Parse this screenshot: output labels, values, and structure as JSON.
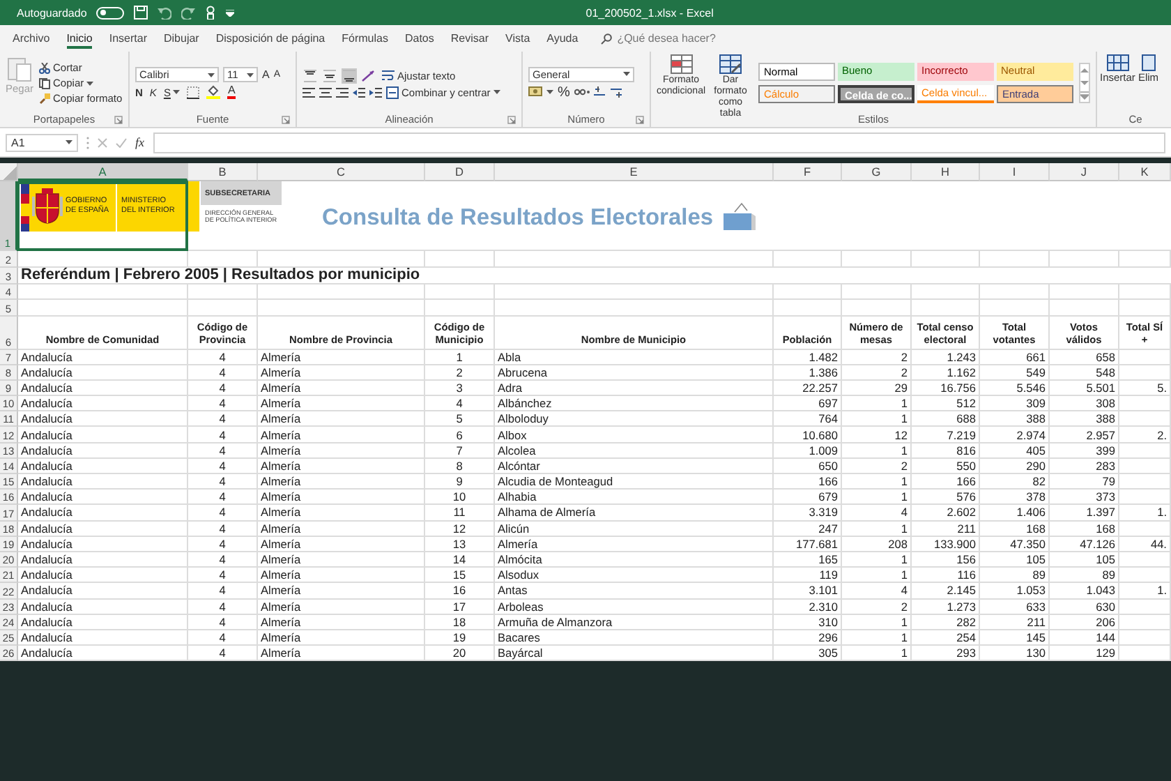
{
  "window": {
    "title": "01_200502_1.xlsx - Excel"
  },
  "quick_access": {
    "autosave_label": "Autoguardado",
    "autosave_on": false
  },
  "menu_tabs": [
    {
      "label": "Archivo",
      "selected": false
    },
    {
      "label": "Inicio",
      "selected": true
    },
    {
      "label": "Insertar",
      "selected": false
    },
    {
      "label": "Dibujar",
      "selected": false
    },
    {
      "label": "Disposición de página",
      "selected": false
    },
    {
      "label": "Fórmulas",
      "selected": false
    },
    {
      "label": "Datos",
      "selected": false
    },
    {
      "label": "Revisar",
      "selected": false
    },
    {
      "label": "Vista",
      "selected": false
    },
    {
      "label": "Ayuda",
      "selected": false
    }
  ],
  "tell_me": {
    "placeholder": "¿Qué desea hacer?"
  },
  "ribbon": [
    {
      "kind": "clipboard",
      "name": "Portapapeles",
      "paste": "Pegar",
      "paste_disabled": true,
      "cut": "Cortar",
      "copy": "Copiar",
      "format_painter": "Copiar formato"
    },
    {
      "kind": "font",
      "name": "Fuente",
      "font_name": "Calibri",
      "font_size": "11",
      "grow": "A",
      "shrink": "A",
      "bold": "N",
      "italic": "K",
      "underline": "S",
      "font_color": "A"
    },
    {
      "kind": "alignment",
      "name": "Alineación",
      "vertical": [
        {
          "selected": false
        },
        {
          "selected": false
        },
        {
          "selected": true
        }
      ],
      "wrap": "Ajustar texto",
      "merge": "Combinar y centrar"
    },
    {
      "kind": "number",
      "name": "Número",
      "format": "General",
      "percent": "%"
    },
    {
      "kind": "styles",
      "name": "Estilos",
      "conditional": "Formato condicional",
      "as_table": "Dar formato como tabla",
      "cell_styles": [
        {
          "kind": "normal",
          "label": "Normal"
        },
        {
          "kind": "good",
          "label": "Bueno"
        },
        {
          "kind": "bad",
          "label": "Incorrecto"
        },
        {
          "kind": "neutral",
          "label": "Neutral"
        },
        {
          "kind": "calculation",
          "label": "Cálculo"
        },
        {
          "kind": "check",
          "label": "Celda de co..."
        },
        {
          "kind": "linked",
          "label": "Celda vincul..."
        },
        {
          "kind": "input",
          "label": "Entrada"
        }
      ]
    },
    {
      "kind": "cells",
      "name": "Ce",
      "insert": "Insertar",
      "delete": "Elim"
    }
  ],
  "formula_bar": {
    "name_box": "A1",
    "function_label": "fx"
  },
  "sheet": {
    "columns": [
      {
        "label": "A",
        "selected": true
      },
      {
        "label": "B",
        "selected": false
      },
      {
        "label": "C",
        "selected": false
      },
      {
        "label": "D",
        "selected": false
      },
      {
        "label": "E",
        "selected": false
      },
      {
        "label": "F",
        "selected": false
      },
      {
        "label": "G",
        "selected": false
      },
      {
        "label": "H",
        "selected": false
      },
      {
        "label": "I",
        "selected": false
      },
      {
        "label": "J",
        "selected": false
      },
      {
        "label": "K",
        "selected": false
      }
    ],
    "rows": [
      {
        "kind": "banner",
        "number": "1",
        "selected": true,
        "government": "GOBIERNO DE ESPAÑA",
        "ministry": "MINISTERIO DEL INTERIOR",
        "undersecretariat": "SUBSECRETARIA",
        "directorate": "DIRECCIÓN GENERAL DE POLÍTICA INTERIOR",
        "title": "Consulta de Resultados Electorales"
      },
      {
        "kind": "blank",
        "number": "2",
        "selected": false
      },
      {
        "kind": "title",
        "number": "3",
        "selected": false,
        "text": "Referéndum | Febrero 2005 | Resultados por municipio"
      },
      {
        "kind": "blank",
        "number": "4",
        "selected": false
      },
      {
        "kind": "blank",
        "number": "5",
        "selected": false
      },
      {
        "kind": "header",
        "number": "6",
        "selected": false,
        "cells": [
          "Nombre de Comunidad",
          "Código de Provincia",
          "Nombre de Provincia",
          "Código de Municipio",
          "Nombre de Municipio",
          "Población",
          "Número de mesas",
          "Total censo electoral",
          "Total votantes",
          "Votos válidos",
          "Total SÍ +"
        ]
      },
      {
        "kind": "data",
        "number": "7",
        "selected": false,
        "cells": [
          "Andalucía",
          "4",
          "Almería",
          "1",
          "Abla",
          "1.482",
          "2",
          "1.243",
          "661",
          "658"
        ]
      },
      {
        "kind": "data",
        "number": "8",
        "selected": false,
        "cells": [
          "Andalucía",
          "4",
          "Almería",
          "2",
          "Abrucena",
          "1.386",
          "2",
          "1.162",
          "549",
          "548"
        ]
      },
      {
        "kind": "data",
        "number": "9",
        "selected": false,
        "cells": [
          "Andalucía",
          "4",
          "Almería",
          "3",
          "Adra",
          "22.257",
          "29",
          "16.756",
          "5.546",
          "5.501",
          "5."
        ]
      },
      {
        "kind": "data",
        "number": "10",
        "selected": false,
        "cells": [
          "Andalucía",
          "4",
          "Almería",
          "4",
          "Albánchez",
          "697",
          "1",
          "512",
          "309",
          "308"
        ]
      },
      {
        "kind": "data",
        "number": "11",
        "selected": false,
        "cells": [
          "Andalucía",
          "4",
          "Almería",
          "5",
          "Alboloduy",
          "764",
          "1",
          "688",
          "388",
          "388"
        ]
      },
      {
        "kind": "data",
        "number": "12",
        "selected": false,
        "cells": [
          "Andalucía",
          "4",
          "Almería",
          "6",
          "Albox",
          "10.680",
          "12",
          "7.219",
          "2.974",
          "2.957",
          "2."
        ]
      },
      {
        "kind": "data",
        "number": "13",
        "selected": false,
        "cells": [
          "Andalucía",
          "4",
          "Almería",
          "7",
          "Alcolea",
          "1.009",
          "1",
          "816",
          "405",
          "399"
        ]
      },
      {
        "kind": "data",
        "number": "14",
        "selected": false,
        "cells": [
          "Andalucía",
          "4",
          "Almería",
          "8",
          "Alcóntar",
          "650",
          "2",
          "550",
          "290",
          "283"
        ]
      },
      {
        "kind": "data",
        "number": "15",
        "selected": false,
        "cells": [
          "Andalucía",
          "4",
          "Almería",
          "9",
          "Alcudia de Monteagud",
          "166",
          "1",
          "166",
          "82",
          "79"
        ]
      },
      {
        "kind": "data",
        "number": "16",
        "selected": false,
        "cells": [
          "Andalucía",
          "4",
          "Almería",
          "10",
          "Alhabia",
          "679",
          "1",
          "576",
          "378",
          "373"
        ]
      },
      {
        "kind": "data",
        "number": "17",
        "selected": false,
        "cells": [
          "Andalucía",
          "4",
          "Almería",
          "11",
          "Alhama de Almería",
          "3.319",
          "4",
          "2.602",
          "1.406",
          "1.397",
          "1."
        ]
      },
      {
        "kind": "data",
        "number": "18",
        "selected": false,
        "cells": [
          "Andalucía",
          "4",
          "Almería",
          "12",
          "Alicún",
          "247",
          "1",
          "211",
          "168",
          "168"
        ]
      },
      {
        "kind": "data",
        "number": "19",
        "selected": false,
        "cells": [
          "Andalucía",
          "4",
          "Almería",
          "13",
          "Almería",
          "177.681",
          "208",
          "133.900",
          "47.350",
          "47.126",
          "44."
        ]
      },
      {
        "kind": "data",
        "number": "20",
        "selected": false,
        "cells": [
          "Andalucía",
          "4",
          "Almería",
          "14",
          "Almócita",
          "165",
          "1",
          "156",
          "105",
          "105"
        ]
      },
      {
        "kind": "data",
        "number": "21",
        "selected": false,
        "cells": [
          "Andalucía",
          "4",
          "Almería",
          "15",
          "Alsodux",
          "119",
          "1",
          "116",
          "89",
          "89"
        ]
      },
      {
        "kind": "data",
        "number": "22",
        "selected": false,
        "cells": [
          "Andalucía",
          "4",
          "Almería",
          "16",
          "Antas",
          "3.101",
          "4",
          "2.145",
          "1.053",
          "1.043",
          "1."
        ]
      },
      {
        "kind": "data",
        "number": "23",
        "selected": false,
        "cells": [
          "Andalucía",
          "4",
          "Almería",
          "17",
          "Arboleas",
          "2.310",
          "2",
          "1.273",
          "633",
          "630"
        ]
      },
      {
        "kind": "data",
        "number": "24",
        "selected": false,
        "cells": [
          "Andalucía",
          "4",
          "Almería",
          "18",
          "Armuña de Almanzora",
          "310",
          "1",
          "282",
          "211",
          "206"
        ]
      },
      {
        "kind": "data",
        "number": "25",
        "selected": false,
        "cells": [
          "Andalucía",
          "4",
          "Almería",
          "19",
          "Bacares",
          "296",
          "1",
          "254",
          "145",
          "144"
        ]
      },
      {
        "kind": "data",
        "number": "26",
        "selected": false,
        "cells": [
          "Andalucía",
          "4",
          "Almería",
          "20",
          "Bayárcal",
          "305",
          "1",
          "293",
          "130",
          "129"
        ]
      }
    ]
  }
}
